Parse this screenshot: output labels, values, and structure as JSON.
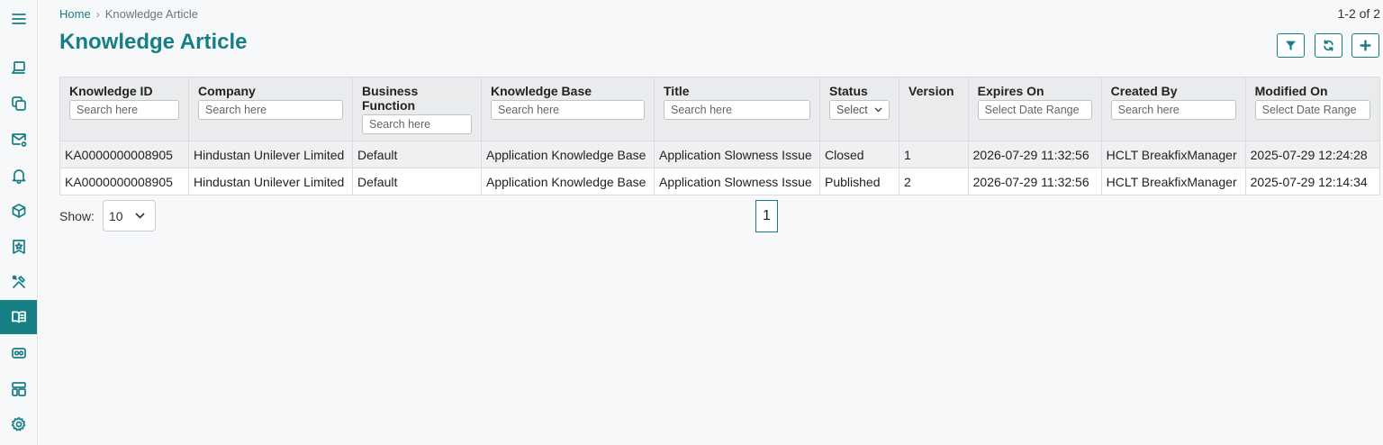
{
  "sidebar": {
    "items": [
      {
        "icon": "hamburger-menu-icon",
        "active": false
      },
      {
        "icon": "laptop-icon",
        "active": false
      },
      {
        "icon": "copy-icon",
        "active": false
      },
      {
        "icon": "mail-settings-icon",
        "active": false
      },
      {
        "icon": "bell-icon",
        "active": false
      },
      {
        "icon": "cube-icon",
        "active": false
      },
      {
        "icon": "bookmark-star-icon",
        "active": false
      },
      {
        "icon": "tools-icon",
        "active": false
      },
      {
        "icon": "open-book-icon",
        "active": true
      },
      {
        "icon": "id-card-icon",
        "active": false
      },
      {
        "icon": "layout-icon",
        "active": false
      },
      {
        "icon": "gear-icon",
        "active": false
      }
    ]
  },
  "breadcrumb": {
    "home": "Home",
    "separator": "›",
    "current": "Knowledge Article"
  },
  "page": {
    "title": "Knowledge Article",
    "record_count": "1-2 of 2"
  },
  "toolbar": {
    "filter_icon": "filter-icon",
    "refresh_icon": "refresh-icon",
    "add_icon": "plus-icon"
  },
  "table": {
    "columns": [
      {
        "label": "Knowledge ID",
        "filter": "text",
        "placeholder": "Search here"
      },
      {
        "label": "Company",
        "filter": "text",
        "placeholder": "Search here"
      },
      {
        "label": "Business Function",
        "filter": "text",
        "placeholder": "Search here"
      },
      {
        "label": "Knowledge Base",
        "filter": "text",
        "placeholder": "Search here"
      },
      {
        "label": "Title",
        "filter": "text",
        "placeholder": "Search here"
      },
      {
        "label": "Status",
        "filter": "select",
        "placeholder": "Select"
      },
      {
        "label": "Version",
        "filter": "none",
        "placeholder": ""
      },
      {
        "label": "Expires On",
        "filter": "text",
        "placeholder": "Select Date Range"
      },
      {
        "label": "Created By",
        "filter": "text",
        "placeholder": "Search here"
      },
      {
        "label": "Modified On",
        "filter": "text",
        "placeholder": "Select Date Range"
      }
    ],
    "rows": [
      [
        "KA0000000008905",
        "Hindustan Unilever Limited",
        "Default",
        "Application Knowledge Base",
        "Application Slowness Issue",
        "Closed",
        "1",
        "2026-07-29 11:32:56",
        "HCLT BreakfixManager",
        "2025-07-29 12:24:28"
      ],
      [
        "KA0000000008905",
        "Hindustan Unilever Limited",
        "Default",
        "Application Knowledge Base",
        "Application Slowness Issue",
        "Published",
        "2",
        "2026-07-29 11:32:56",
        "HCLT BreakfixManager",
        "2025-07-29 12:14:34"
      ]
    ]
  },
  "pagination": {
    "show_label": "Show:",
    "page_size": "10",
    "current_page": "1"
  },
  "colors": {
    "accent": "#167f86",
    "header_bg": "#e9ebed",
    "row_alt": "#eff0f2"
  }
}
